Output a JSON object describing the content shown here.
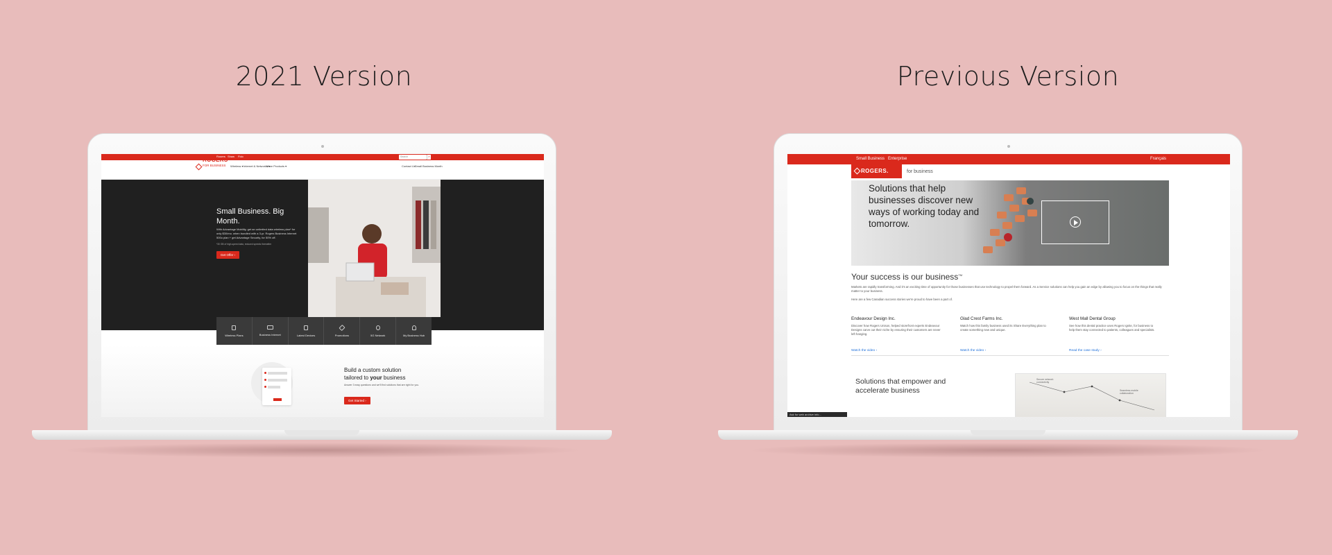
{
  "headings": {
    "left": "2021 Version",
    "right": "Previous Version"
  },
  "left_site": {
    "top_links": [
      "Rogers",
      "Shaw",
      "Fido"
    ],
    "search_placeholder": "Search",
    "logo": "ROGERS",
    "logo_sub": "FOR BUSINESS",
    "nav": [
      "Wireless ▾",
      "Internet & Networks ▾",
      "More Products ▾"
    ],
    "nav_right": [
      "Contact Us",
      "Small Business Month"
    ],
    "hero": {
      "title": "Small Business. Big Month.",
      "body": "With Advantage Mobility, get an unlimited data wireless plan* for only $30/mo. when bundled with a 3-yr. Rogers Business Internet 500u plan + get Advantage Security, for 50% off.",
      "note": "*30 GB of high-speed data, reduced speeds thereafter",
      "button": "Get Offer ›"
    },
    "tiles": [
      "Wireless Plans",
      "Business Internet",
      "Latest Devices",
      "Promotions",
      "5G Network",
      "My Business Hub"
    ],
    "build": {
      "title_a": "Build a custom solution",
      "title_b": "tailored to ",
      "title_bold": "your",
      "title_c": " business",
      "body": "Answer 3 easy questions and we'll find solutions that are right for you.",
      "button": "Get Started ›"
    }
  },
  "right_site": {
    "top_links": [
      "Small Business",
      "Enterprise"
    ],
    "lang": "Français",
    "logo": "ROGERS.",
    "for_business": "for business",
    "hero_text": "Solutions that help businesses discover new ways of working today and tomorrow.",
    "success_title": "Your success is our business",
    "tm": "TM",
    "para1": "Markets are rapidly transforming. And it's an exciting time of opportunity for those businesses that use technology to propel them forward. As a Service solutions can help you gain an edge by allowing you to focus on the things that really matter to your business.",
    "para2": "Here are a few Canadian success stories we're proud to have been a part of.",
    "stories": [
      {
        "title": "Endeavour Design Inc.",
        "body": "Discover how Rogers Unison, helped storefront experts Endeavour Designs carve out their niche by ensuring their customers are never left hanging.",
        "link": "Watch the video ›"
      },
      {
        "title": "Glad Crest Farms Inc.",
        "body": "Watch how this family business used its Share Everything plan to create something new and unique.",
        "link": "Watch the video ›"
      },
      {
        "title": "West Mall Dental Group",
        "body": "See how this dental practice uses Rogers Ignite, for business to help them stay connected to patients, colleagues and specialists.",
        "link": "Read the case study ›"
      }
    ],
    "empower": "Solutions that empower and accelerate business",
    "map_labels": [
      "Secure network connectivity",
      "Seamless mobile collaboration"
    ],
    "chat": "Ask for web archive info..."
  }
}
